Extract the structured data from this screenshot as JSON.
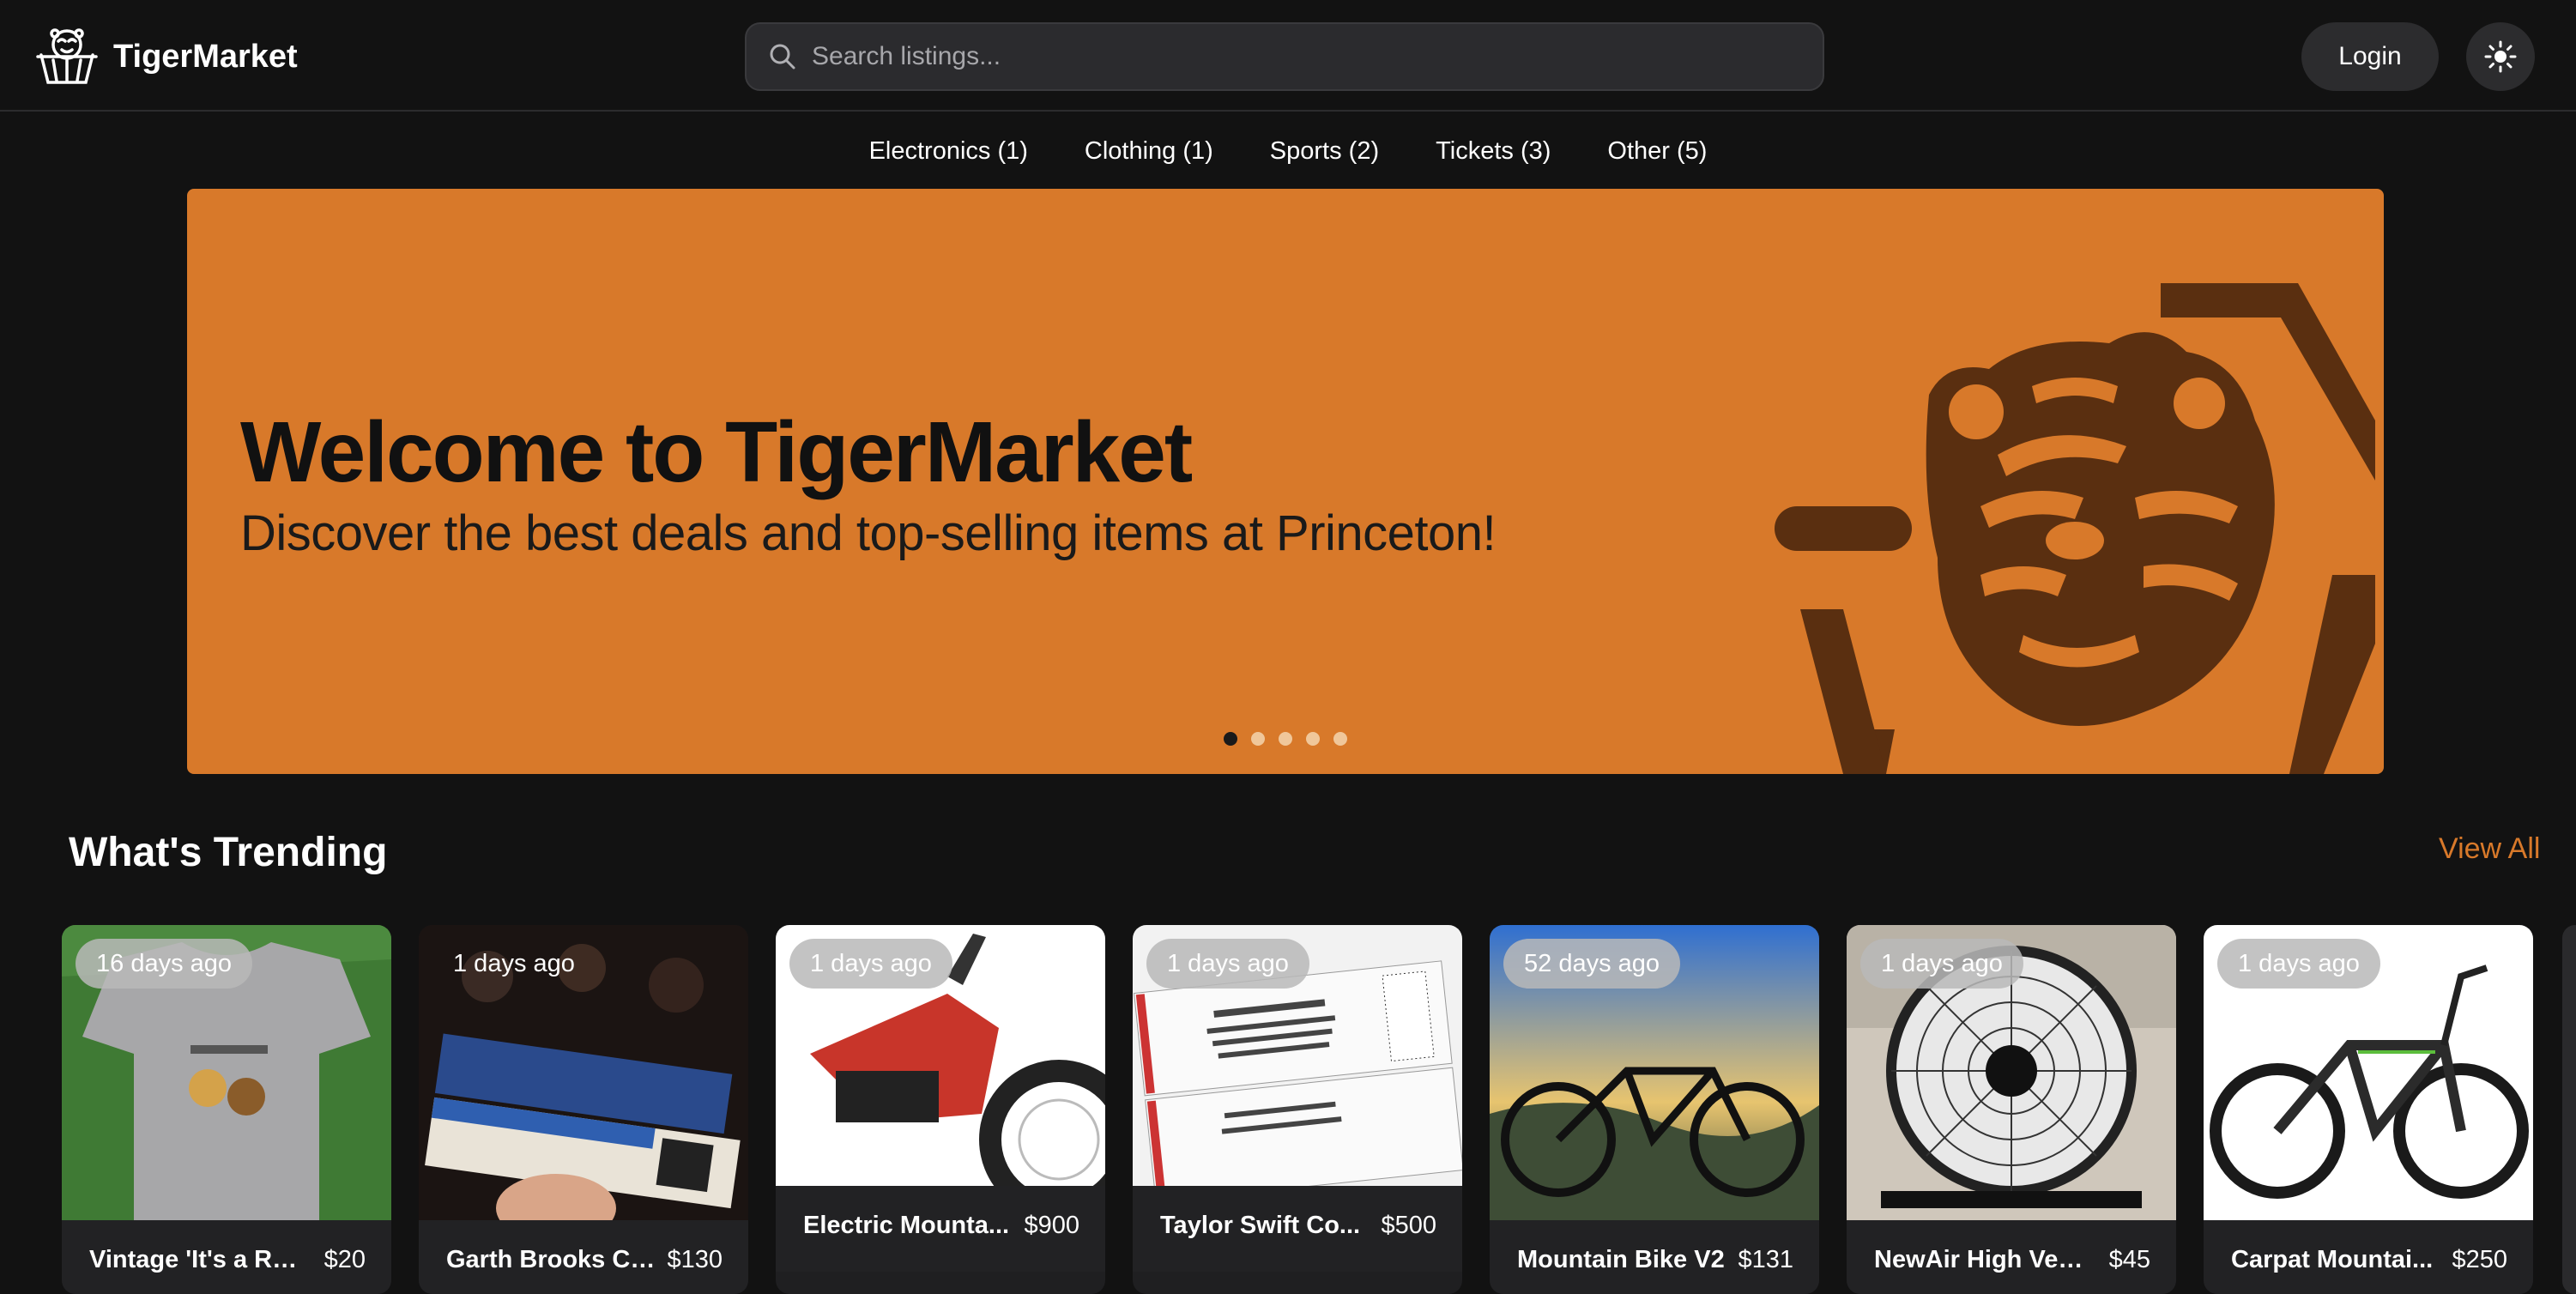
{
  "header": {
    "brand": "TigerMarket",
    "search_placeholder": "Search listings...",
    "login_label": "Login"
  },
  "categories": [
    {
      "label": "Electronics (1)"
    },
    {
      "label": "Clothing (1)"
    },
    {
      "label": "Sports (2)"
    },
    {
      "label": "Tickets (3)"
    },
    {
      "label": "Other (5)"
    }
  ],
  "hero": {
    "title": "Welcome to TigerMarket",
    "subtitle": "Discover the best deals and top-selling items at Princeton!",
    "slide_count": 5,
    "active_slide": 1,
    "color": "#d8792a"
  },
  "trending": {
    "title": "What's Trending",
    "view_all": "View All",
    "items": [
      {
        "age": "16 days ago",
        "title": "Vintage 'It's a Re...",
        "price": "$20"
      },
      {
        "age": "1 days ago",
        "title": "Garth Brooks Co...",
        "price": "$130"
      },
      {
        "age": "1 days ago",
        "title": "Electric Mounta...",
        "price": "$900"
      },
      {
        "age": "1 days ago",
        "title": "Taylor Swift Co...",
        "price": "$500"
      },
      {
        "age": "52 days ago",
        "title": "Mountain Bike V2",
        "price": "$131"
      },
      {
        "age": "1 days ago",
        "title": "NewAir High Velo...",
        "price": "$45"
      },
      {
        "age": "1 days ago",
        "title": "Carpat Mountai...",
        "price": "$250"
      }
    ]
  },
  "icons": {
    "logo": "tiger-basket-logo",
    "search": "search-icon",
    "theme": "sun-icon"
  }
}
